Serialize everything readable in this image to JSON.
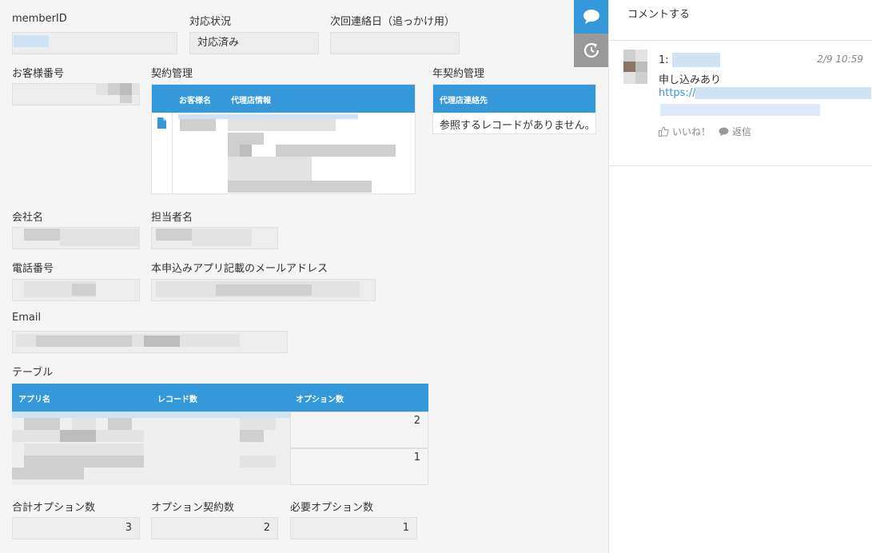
{
  "form": {
    "member_id": {
      "label": "memberID",
      "value": ""
    },
    "status": {
      "label": "対応状況",
      "value": "対応済み"
    },
    "next_contact": {
      "label": "次回連絡日（追っかけ用）",
      "value": ""
    },
    "customer_no": {
      "label": "お客様番号",
      "value": ""
    },
    "contract": {
      "label": "契約管理",
      "columns": [
        "お客様名",
        "代理店情報"
      ]
    },
    "annual_contract": {
      "label": "年契約管理",
      "columns": [
        "代理店連絡先"
      ],
      "empty_message": "参照するレコードがありません。"
    },
    "company": {
      "label": "会社名",
      "value": ""
    },
    "person": {
      "label": "担当者名",
      "value": ""
    },
    "phone": {
      "label": "電話番号",
      "value": ""
    },
    "app_email": {
      "label": "本申込みアプリ記載のメールアドレス",
      "value": ""
    },
    "email": {
      "label": "Email",
      "value": ""
    },
    "table": {
      "label": "テーブル",
      "columns": [
        "アプリ名",
        "レコード数",
        "オプション数"
      ],
      "rows": [
        {
          "app": "",
          "records": "",
          "options": "2"
        },
        {
          "app": "",
          "records": "",
          "options": "1"
        }
      ]
    },
    "total_options": {
      "label": "合計オプション数",
      "value": "3"
    },
    "contract_options": {
      "label": "オプション契約数",
      "value": "2"
    },
    "required_options": {
      "label": "必要オプション数",
      "value": "1"
    }
  },
  "sidebar": {
    "comment_icon": "speech-bubble-icon",
    "history_icon": "history-icon"
  },
  "comments": {
    "placeholder": "コメントする",
    "items": [
      {
        "number": "1:",
        "time": "2/9 10:59",
        "body": "申し込みあり",
        "link": "https://",
        "like_label": "いいね！",
        "reply_label": "返信"
      }
    ]
  },
  "colors": {
    "accent": "#3498db",
    "panel_bg": "#ffffff",
    "page_bg": "#f5f5f5"
  }
}
